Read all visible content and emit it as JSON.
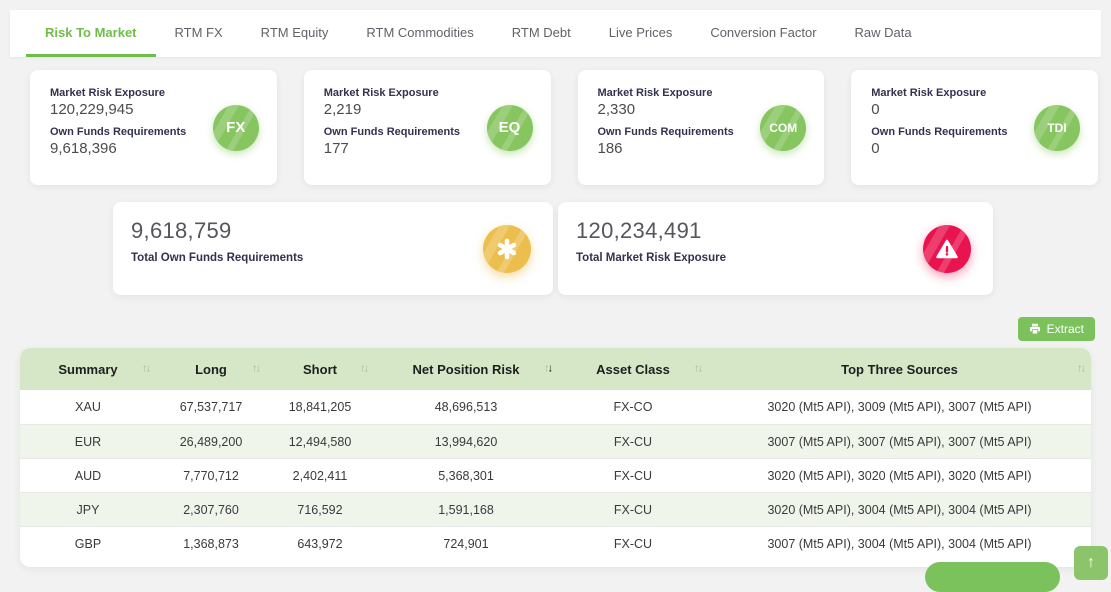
{
  "tabs": [
    {
      "label": "Risk To Market",
      "active": true
    },
    {
      "label": "RTM FX",
      "active": false
    },
    {
      "label": "RTM Equity",
      "active": false
    },
    {
      "label": "RTM Commodities",
      "active": false
    },
    {
      "label": "RTM Debt",
      "active": false
    },
    {
      "label": "Live Prices",
      "active": false
    },
    {
      "label": "Conversion Factor",
      "active": false
    },
    {
      "label": "Raw Data",
      "active": false
    }
  ],
  "exposure_cards": [
    {
      "metric1_label": "Market Risk Exposure",
      "metric1_value": "120,229,945",
      "metric2_label": "Own Funds Requirements",
      "metric2_value": "9,618,396",
      "badge": "FX"
    },
    {
      "metric1_label": "Market Risk Exposure",
      "metric1_value": "2,219",
      "metric2_label": "Own Funds Requirements",
      "metric2_value": "177",
      "badge": "EQ"
    },
    {
      "metric1_label": "Market Risk Exposure",
      "metric1_value": "2,330",
      "metric2_label": "Own Funds Requirements",
      "metric2_value": "186",
      "badge": "COM"
    },
    {
      "metric1_label": "Market Risk Exposure",
      "metric1_value": "0",
      "metric2_label": "Own Funds Requirements",
      "metric2_value": "0",
      "badge": "TDI"
    }
  ],
  "summary_cards": [
    {
      "value": "9,618,759",
      "label": "Total Own Funds Requirements",
      "icon": "asterisk-icon"
    },
    {
      "value": "120,234,491",
      "label": "Total Market Risk Exposure",
      "icon": "warning-icon"
    }
  ],
  "toolbar": {
    "extract_label": "Extract"
  },
  "table": {
    "columns": [
      {
        "label": "Summary",
        "sorted": null
      },
      {
        "label": "Long",
        "sorted": null
      },
      {
        "label": "Short",
        "sorted": null
      },
      {
        "label": "Net Position Risk",
        "sorted": "desc"
      },
      {
        "label": "Asset Class",
        "sorted": null
      },
      {
        "label": "Top Three Sources",
        "sorted": null
      }
    ],
    "rows": [
      [
        "XAU",
        "67,537,717",
        "18,841,205",
        "48,696,513",
        "FX-CO",
        "3020 (Mt5 API), 3009 (Mt5 API), 3007 (Mt5 API)"
      ],
      [
        "EUR",
        "26,489,200",
        "12,494,580",
        "13,994,620",
        "FX-CU",
        "3007 (Mt5 API), 3007 (Mt5 API), 3007 (Mt5 API)"
      ],
      [
        "AUD",
        "7,770,712",
        "2,402,411",
        "5,368,301",
        "FX-CU",
        "3020 (Mt5 API), 3020 (Mt5 API), 3020 (Mt5 API)"
      ],
      [
        "JPY",
        "2,307,760",
        "716,592",
        "1,591,168",
        "FX-CU",
        "3020 (Mt5 API), 3004 (Mt5 API), 3004 (Mt5 API)"
      ],
      [
        "GBP",
        "1,368,873",
        "643,972",
        "724,901",
        "FX-CU",
        "3007 (Mt5 API), 3004 (Mt5 API), 3004 (Mt5 API)"
      ]
    ]
  },
  "colors": {
    "accent_green": "#6fbe4b",
    "badge_green": "#86c55f",
    "header_green": "#d6e7c7",
    "stripe_green": "#f0f5ec",
    "warning_yellow": "#ecbe4e",
    "alert_red": "#e9134f"
  }
}
